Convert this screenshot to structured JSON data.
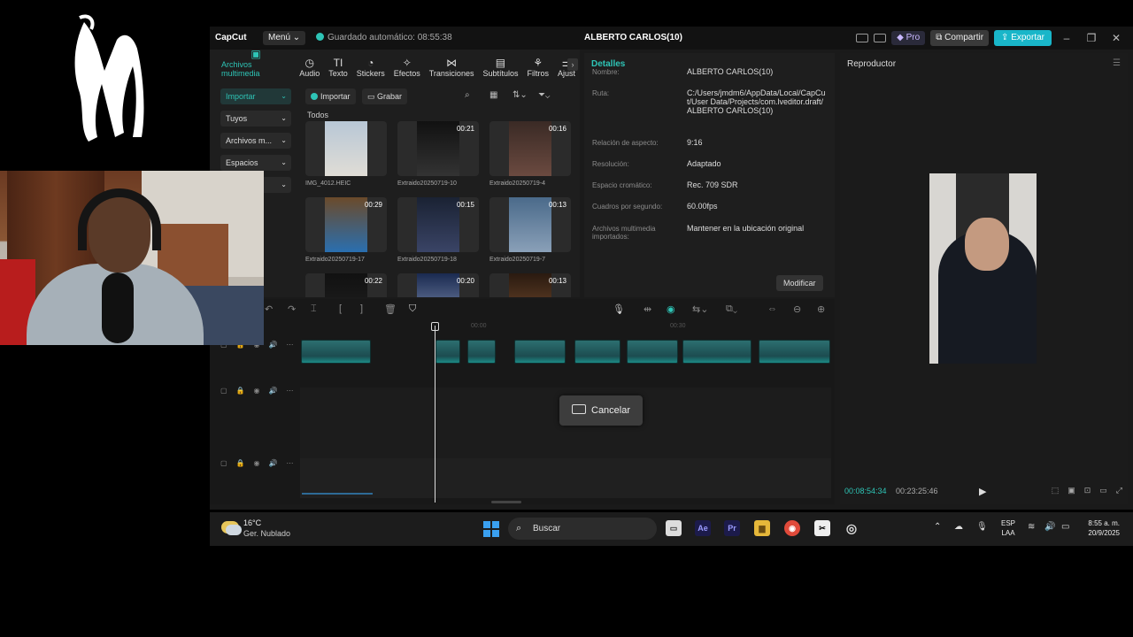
{
  "app": {
    "logo_text": "CapCut",
    "menu_label": "Menú",
    "autosave_text": "Guardado automático: 08:55:38",
    "project_title": "ALBERTO CARLOS(10)",
    "pro_label": "Pro",
    "share_label": "Compartir",
    "export_label": "Exportar"
  },
  "toolbar": {
    "items": [
      {
        "label": "Archivos multimedia",
        "icon": "media-icon",
        "glyph": "▣",
        "active": true
      },
      {
        "label": "Audio",
        "icon": "audio-icon",
        "glyph": "◷"
      },
      {
        "label": "Texto",
        "icon": "text-icon",
        "glyph": "TI"
      },
      {
        "label": "Stickers",
        "icon": "sticker-icon",
        "glyph": "◔"
      },
      {
        "label": "Efectos",
        "icon": "effects-icon",
        "glyph": "✧"
      },
      {
        "label": "Transiciones",
        "icon": "transition-icon",
        "glyph": "⋈"
      },
      {
        "label": "Subtítulos",
        "icon": "subtitle-icon",
        "glyph": "▤"
      },
      {
        "label": "Filtros",
        "icon": "filter-icon",
        "glyph": "⚘"
      },
      {
        "label": "Ajust",
        "icon": "adjust-icon",
        "glyph": "⚌"
      }
    ]
  },
  "sidenav": {
    "items": [
      {
        "label": "Importar",
        "active": true
      },
      {
        "label": "Tuyos"
      },
      {
        "label": "Archivos m..."
      },
      {
        "label": "Espacios"
      },
      {
        "label": ""
      }
    ]
  },
  "media": {
    "import_label": "Importar",
    "record_label": "Grabar",
    "section_label": "Todos",
    "items": [
      {
        "name": "IMG_4012.HEIC",
        "duration": ""
      },
      {
        "name": "Extraido20250719-10",
        "duration": "00:21"
      },
      {
        "name": "Extraido20250719-4",
        "duration": "00:16"
      },
      {
        "name": "Extraido20250719-17",
        "duration": "00:29"
      },
      {
        "name": "Extraido20250719-18",
        "duration": "00:15"
      },
      {
        "name": "Extraido20250719-7",
        "duration": "00:13"
      },
      {
        "name": "",
        "duration": "00:22"
      },
      {
        "name": "",
        "duration": "00:20"
      },
      {
        "name": "",
        "duration": "00:13"
      }
    ]
  },
  "details": {
    "title": "Detalles",
    "rows": [
      {
        "label": "Nombre:",
        "value": "ALBERTO CARLOS(10)"
      },
      {
        "label": "Ruta:",
        "value": "C:/Users/jmdm6/AppData/Local/CapCut/User Data/Projects/com.lveditor.draft/ALBERTO CARLOS(10)"
      },
      {
        "label": "Relación de aspecto:",
        "value": "9:16"
      },
      {
        "label": "Resolución:",
        "value": "Adaptado"
      },
      {
        "label": "Espacio cromático:",
        "value": "Rec. 709 SDR"
      },
      {
        "label": "Cuadros por segundo:",
        "value": "60.00fps"
      },
      {
        "label": "Archivos multimedia importados:",
        "value": "Mantener en la ubicación original"
      }
    ],
    "modify_label": "Modificar"
  },
  "player": {
    "title": "Reproductor",
    "current_time": "00:08:54:34",
    "total_time": "00:23:25:46"
  },
  "timeline": {
    "ruler_labels": [
      "00:00",
      "00:30"
    ],
    "cancel_label": "Cancelar"
  },
  "taskbar": {
    "temperature": "16°C",
    "condition": "Ger. Nublado",
    "search_placeholder": "Buscar",
    "lang_line1": "ESP",
    "lang_line2": "LAA",
    "time": "8:55 a. m.",
    "date": "20/9/2025"
  },
  "colors": {
    "accent": "#2ec4b6",
    "export": "#19b6c9"
  }
}
